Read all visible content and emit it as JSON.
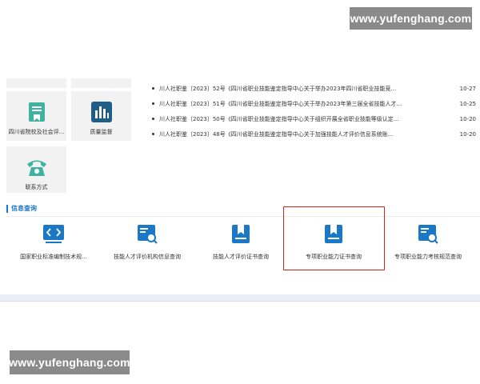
{
  "watermark": {
    "text": "www.yufenghang.com"
  },
  "tiles": [
    {
      "label": "四川省院校及社会评...",
      "icon": "certificate-icon"
    },
    {
      "label": "质量监督",
      "icon": "bar-chart-icon"
    },
    {
      "label": "联系方式",
      "icon": "telephone-icon"
    }
  ],
  "news": [
    {
      "title": "川人社职鉴〔2023〕52号《四川省职业技能鉴定指导中心关于举办2023年四川省职业技能竞...",
      "date": "10-27"
    },
    {
      "title": "川人社职鉴〔2023〕51号《四川省职业技能鉴定指导中心关于举办2023年第三届全省技能人才...",
      "date": "10-25"
    },
    {
      "title": "川人社职鉴〔2023〕50号《四川省职业技能鉴定指导中心关于组织开展全省职业技能等级认定...",
      "date": "10-20"
    },
    {
      "title": "川人社职鉴〔2023〕48号《四川省职业技能鉴定指导中心关于加强技能人才评价信息系统账...",
      "date": "10-20"
    }
  ],
  "section": {
    "title": "信息查询"
  },
  "queries": [
    {
      "label": "国家职业标准编制技术规...",
      "icon": "code-icon"
    },
    {
      "label": "技能人才评价机构信息查询",
      "icon": "search-document-icon"
    },
    {
      "label": "技能人才评价证书查询",
      "icon": "bookmark-icon"
    },
    {
      "label": "专项职业能力证书查询",
      "icon": "bookmark-icon",
      "highlighted": true
    },
    {
      "label": "专项职业能力考核规范查询",
      "icon": "search-document-icon"
    }
  ],
  "colors": {
    "accent": "#1b78c6",
    "tile_icon": "#3fb3a0",
    "highlight": "#d8211b"
  }
}
